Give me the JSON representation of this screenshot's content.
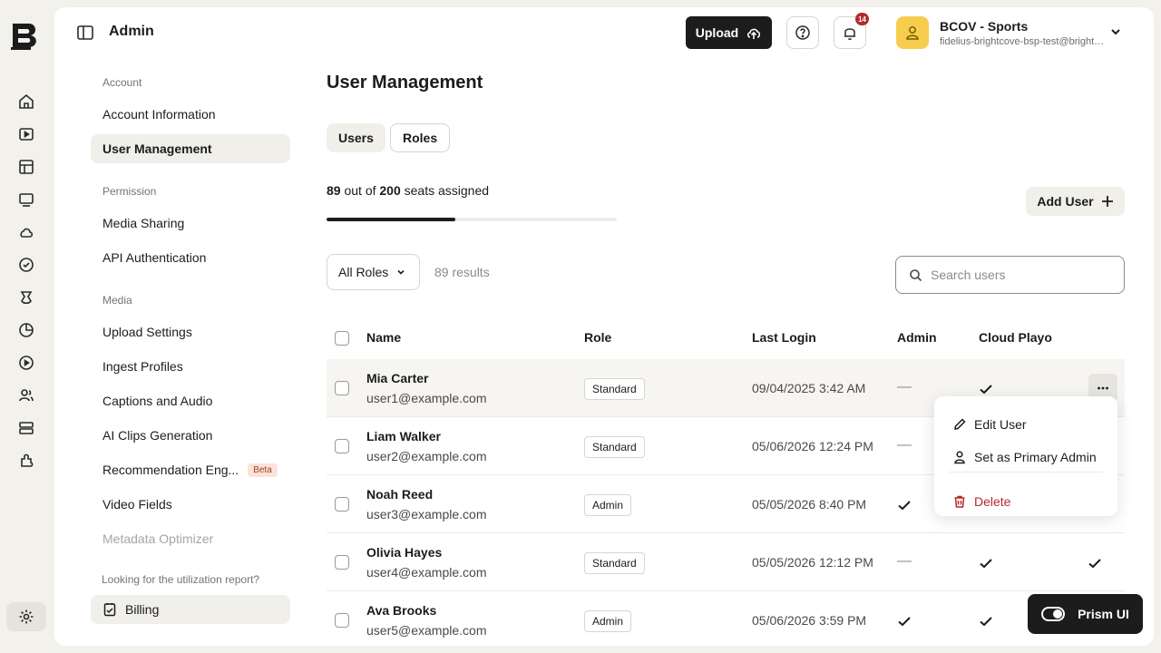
{
  "rail": {
    "logo_icon": "brightcove-logo-icon",
    "items": [
      {
        "name": "home-icon"
      },
      {
        "name": "video-icon"
      },
      {
        "name": "layout-icon"
      },
      {
        "name": "player-icon"
      },
      {
        "name": "cloud-icon"
      },
      {
        "name": "shield-icon"
      },
      {
        "name": "gallery-icon"
      },
      {
        "name": "analytics-icon"
      },
      {
        "name": "live-icon"
      },
      {
        "name": "audience-icon"
      },
      {
        "name": "server-icon"
      },
      {
        "name": "plugins-icon"
      }
    ],
    "settings_icon": "gear-icon"
  },
  "header": {
    "title": "Admin",
    "upload_label": "Upload",
    "notification_count": "14",
    "account_name": "BCOV - Sports",
    "account_email": "fidelius-brightcove-bsp-test@brightcove.com"
  },
  "sidebar": {
    "sections": [
      {
        "label": "Account",
        "items": [
          "Account Information",
          "User Management"
        ]
      },
      {
        "label": "Permission",
        "items": [
          "Media Sharing",
          "API Authentication"
        ]
      },
      {
        "label": "Media",
        "items": [
          "Upload Settings",
          "Ingest Profiles",
          "Captions and Audio",
          "AI Clips Generation",
          "Recommendation Eng...",
          "Video Fields",
          "Metadata Optimizer"
        ]
      }
    ],
    "active_item": "User Management",
    "beta_label": "Beta",
    "hint": "Looking for the utilization report?",
    "billing_label": "Billing"
  },
  "main": {
    "title": "User Management",
    "tabs": [
      "Users",
      "Roles"
    ],
    "selected_tab": "Users",
    "seats_assigned": "89",
    "seats_sep": "out of",
    "seats_total": "200",
    "seats_suffix": "seats assigned",
    "seats_fraction": 0.445,
    "add_user_label": "Add User",
    "role_filter_value": "All Roles",
    "results_text": "89 results",
    "search_placeholder": "Search users"
  },
  "table": {
    "columns": [
      "Name",
      "Role",
      "Last Login",
      "Admin",
      "Cloud Playout"
    ],
    "rows": [
      {
        "name": "Mia Carter",
        "email": "user1@example.com",
        "role": "Standard",
        "last_login": "09/04/2025 3:42 AM",
        "admin": false,
        "cloud_playout": true
      },
      {
        "name": "Liam Walker",
        "email": "user2@example.com",
        "role": "Standard",
        "last_login": "05/06/2026 12:24 PM",
        "admin": false,
        "cloud_playout": null
      },
      {
        "name": "Noah Reed",
        "email": "user3@example.com",
        "role": "Admin",
        "last_login": "05/05/2026 8:40 PM",
        "admin": true,
        "cloud_playout": null
      },
      {
        "name": "Olivia Hayes",
        "email": "user4@example.com",
        "role": "Standard",
        "last_login": "05/05/2026 12:12 PM",
        "admin": false,
        "cloud_playout": true
      },
      {
        "name": "Ava Brooks",
        "email": "user5@example.com",
        "role": "Admin",
        "last_login": "05/06/2026 3:59 PM",
        "admin": true,
        "cloud_playout": true
      }
    ],
    "dash": "—"
  },
  "row_menu": {
    "items": [
      "Edit User",
      "Set as Primary Admin",
      "Delete"
    ],
    "delete_color": "#b52a2a"
  },
  "prism": {
    "label": "Prism UI",
    "enabled": true
  }
}
